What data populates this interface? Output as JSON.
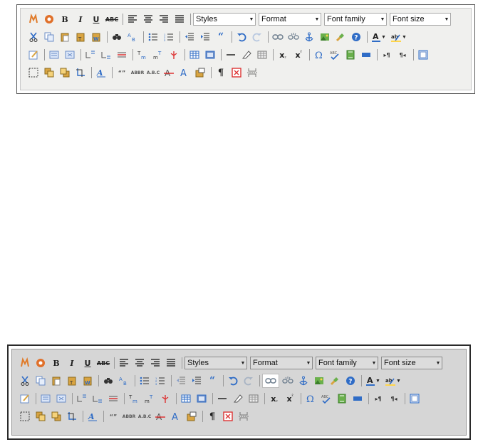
{
  "toolbar": {
    "styles": "Styles",
    "format": "Format",
    "font_family": "Font family",
    "font_size": "Font size",
    "bold": "B",
    "italic": "I",
    "underline": "U",
    "strikethrough": "ABC",
    "acronym": "ABBR",
    "abbr": "A.B.C",
    "sub": "x",
    "sup": "x",
    "paragraph": "¶",
    "ltr": "▸¶",
    "rtl": "¶◂",
    "quote": "“",
    "cite": "“”"
  },
  "colors": {
    "accent": "#2f6cc6",
    "toolbar_bg_top": "#f0f0ee",
    "toolbar_bg_bottom": "#d6d6d6",
    "active_button": "#ffffff"
  },
  "states": {
    "bottom_link_button_highlighted": true
  }
}
